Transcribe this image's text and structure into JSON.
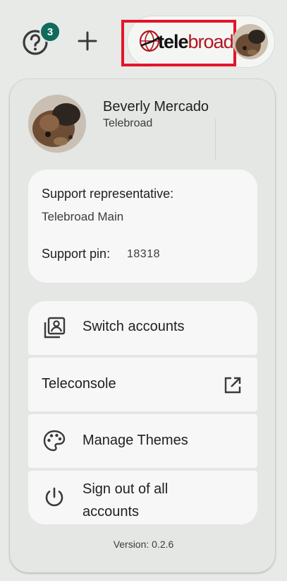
{
  "topbar": {
    "help_badge_count": "3",
    "help_icon": "help-circle-icon",
    "add_icon": "plus-icon",
    "logo": {
      "part1": "tele",
      "part2": "broad",
      "accent": "#e3152b"
    }
  },
  "user": {
    "name": "Beverly Mercado",
    "organization": "Telebroad"
  },
  "support": {
    "representative_label": "Support representative:",
    "representative_value": "Telebroad Main",
    "pin_label": "Support pin:",
    "pin_value": "18318"
  },
  "menu": {
    "items": [
      {
        "label": "Switch accounts",
        "icon": "switch-accounts-icon"
      },
      {
        "label": "Teleconsole",
        "icon": "open-in-new-icon"
      },
      {
        "label": "Manage Themes",
        "icon": "palette-icon"
      },
      {
        "label": "Sign out of all accounts",
        "icon": "power-icon"
      }
    ]
  },
  "footer": {
    "version": "Version: 0.2.6"
  },
  "colors": {
    "badge": "#0f6b5c",
    "panel": "#e4e7e4",
    "card": "#f6f7f6",
    "highlight": "#e3152b"
  }
}
